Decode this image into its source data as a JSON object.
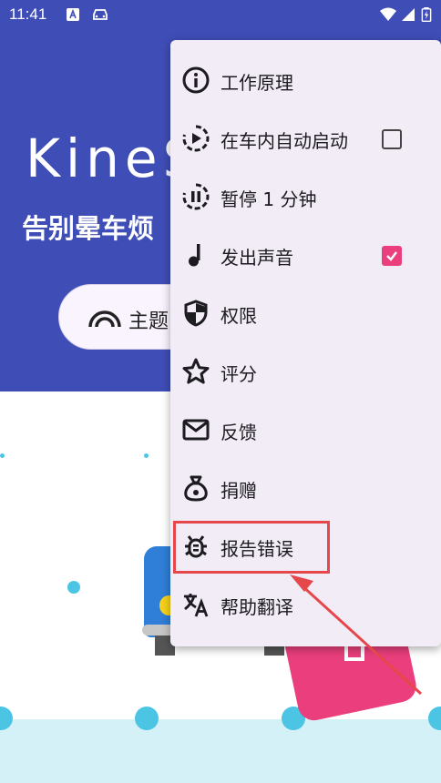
{
  "status_bar": {
    "time": "11:41",
    "left_icons": [
      "a-square-icon",
      "car-icon"
    ],
    "right_icons": [
      "wifi-icon",
      "signal-icon",
      "battery-icon"
    ]
  },
  "header": {
    "app_title": "KineS",
    "subtitle": "告别晕车烦",
    "theme_button_label": "主题"
  },
  "menu": {
    "items": [
      {
        "label": "工作原理",
        "icon": "info-icon"
      },
      {
        "label": "在车内自动启动",
        "icon": "autostart-icon",
        "checkbox": false
      },
      {
        "label": "暂停 1 分钟",
        "icon": "pause-timer-icon"
      },
      {
        "label": "发出声音",
        "icon": "music-note-icon",
        "checkbox": true
      },
      {
        "label": "权限",
        "icon": "shield-icon"
      },
      {
        "label": "评分",
        "icon": "star-icon"
      },
      {
        "label": "反馈",
        "icon": "mail-icon"
      },
      {
        "label": "捐赠",
        "icon": "money-bag-icon"
      },
      {
        "label": "报告错误",
        "icon": "bug-icon"
      },
      {
        "label": "帮助翻译",
        "icon": "translate-icon"
      }
    ]
  },
  "colors": {
    "header_bg": "#3f4db6",
    "menu_bg": "#f1ecf5",
    "accent_pink": "#ea3f7c",
    "annotation_red": "#e5474b",
    "dot_cyan": "#4bc5e3"
  }
}
